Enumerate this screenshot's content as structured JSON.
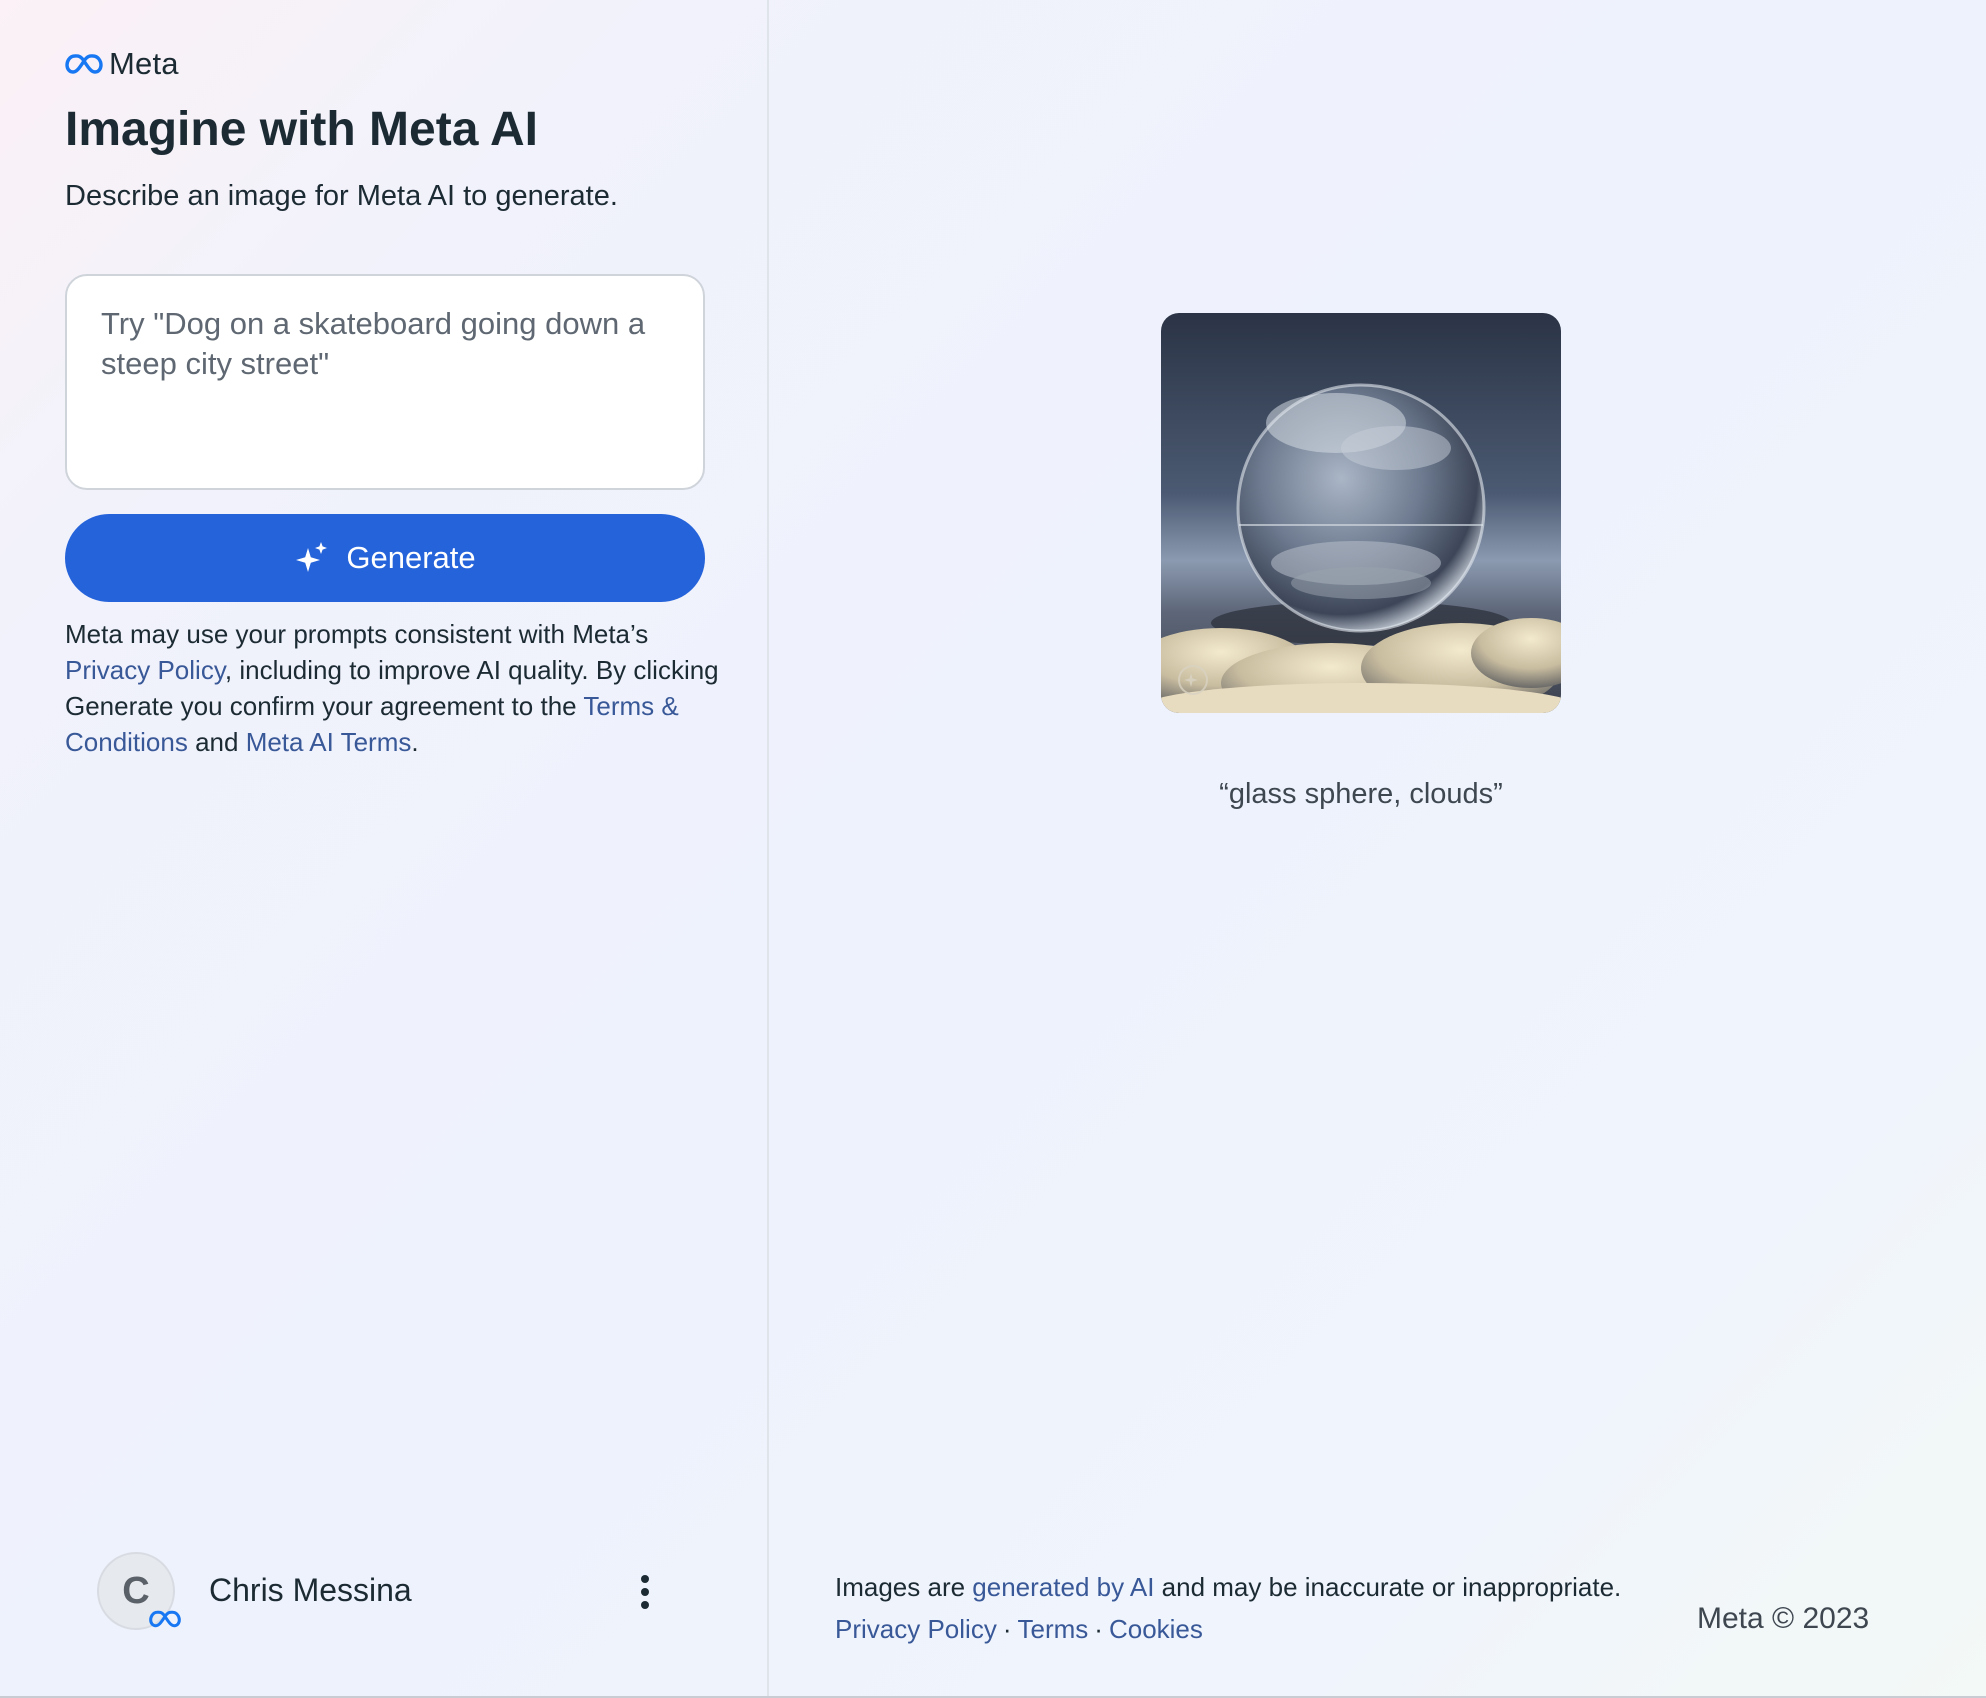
{
  "brand": {
    "name": "Meta",
    "logo_icon": "meta-infinity-icon",
    "accent": "#1877f2"
  },
  "left": {
    "title": "Imagine with Meta AI",
    "subtitle": "Describe an image for Meta AI to generate.",
    "prompt": {
      "value": "",
      "placeholder": "Try \"Dog on a skateboard going down a steep city street\""
    },
    "generate": {
      "label": "Generate",
      "icon": "sparkle-icon",
      "color": "#2563da"
    },
    "disclaimer": {
      "part1": "Meta may use your prompts consistent with Meta’s ",
      "privacy_link": "Privacy Policy",
      "part2": ", including to improve AI quality. By clicking Generate you confirm your agreement to the ",
      "terms_link": "Terms & Conditions",
      "part3": " and ",
      "ai_terms_link": "Meta AI Terms",
      "part4": "."
    },
    "user": {
      "initial": "C",
      "name": "Chris Messina",
      "menu_icon": "more-vertical-icon"
    }
  },
  "right": {
    "example": {
      "caption": "“glass sphere, clouds”",
      "watermark_icon": "meta-ai-watermark-icon"
    },
    "footer": {
      "note_part1": "Images are ",
      "note_link": "generated by AI",
      "note_part2": " and may be inaccurate or inappropriate.",
      "links": {
        "privacy": "Privacy Policy",
        "terms": "Terms",
        "cookies": "Cookies",
        "separator": "·"
      },
      "copyright": "Meta © 2023"
    }
  }
}
